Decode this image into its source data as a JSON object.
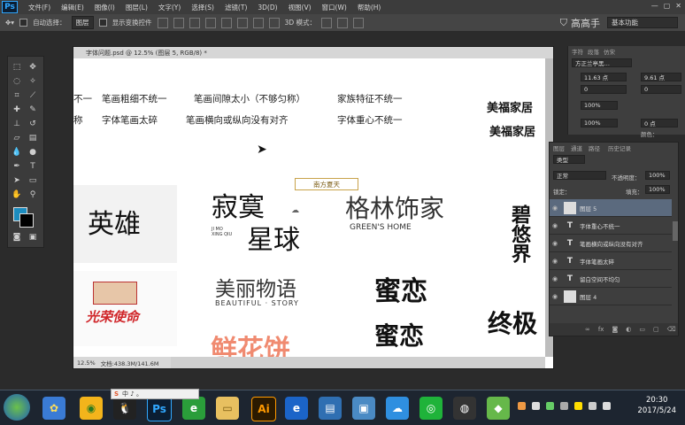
{
  "app": {
    "logo": "Ps"
  },
  "menu": [
    "文件(F)",
    "编辑(E)",
    "图像(I)",
    "图层(L)",
    "文字(Y)",
    "选择(S)",
    "滤镜(T)",
    "3D(D)",
    "视图(V)",
    "窗口(W)",
    "帮助(H)"
  ],
  "options": {
    "auto_select_label": "自动选择：",
    "auto_select_value": "图层",
    "show_transform_label": "显示变换控件",
    "mode_3d": "3D 模式："
  },
  "brand": {
    "name": "高高手"
  },
  "workspace": "基本功能",
  "document": {
    "title": "字体问题.psd @ 12.5% (图层 5, RGB/8) *",
    "zoom": "12.5%",
    "doc_info": "文档:438.3M/141.6M",
    "notes_row1": [
      "不一",
      "笔画粗细不统一",
      "笔画间隙太小（不够匀称）",
      "家族特征不统一"
    ],
    "notes_row2": [
      "称",
      "字体笔画太碎",
      "笔画横向或纵向没有对齐",
      "字体重心不统一"
    ],
    "samples": {
      "yingxiong": "英雄",
      "jimo": "寂寞",
      "xingqiu": "星球",
      "jimo_pinyin": "JI MO\nXING QIU",
      "gelin": "格林饰家",
      "gelin_en": "GREEN'S HOME",
      "meili": "美丽物语",
      "meili_en": "BEAUTIFUL · STORY",
      "milian": "蜜恋",
      "milian2": "蜜恋",
      "guangrong": "光荣使命",
      "xianhuabing": "鲜花饼",
      "zhongji": "终极",
      "meifu1": "美福家居",
      "meifu2": "美福家居",
      "bixi": "碧悠界",
      "badge": "南方夏天"
    }
  },
  "character_panel": {
    "tabs": [
      "字符",
      "段落",
      "仿宋"
    ],
    "font_family": "方正兰亭黑…",
    "font_size": "11.63 点",
    "leading": "9.61 点",
    "kerning": "0",
    "tracking": "0",
    "vscale": "100%",
    "hscale": "100%",
    "baseline": "0 点",
    "color_label": "颜色："
  },
  "layers_panel": {
    "tabs": [
      "图层",
      "通道",
      "路径",
      "历史记录"
    ],
    "filter_label": "类型",
    "blend_mode": "正常",
    "opacity_label": "不透明度：",
    "opacity_value": "100%",
    "lock_label": "锁定：",
    "fill_label": "填充：",
    "fill_value": "100%",
    "layers": [
      {
        "name": "图层 5",
        "kind": "pixel",
        "selected": true
      },
      {
        "name": "字体重心不统一",
        "kind": "text",
        "selected": false
      },
      {
        "name": "笔画横向或纵向没有对齐",
        "kind": "text",
        "selected": false
      },
      {
        "name": "字体笔画太碎",
        "kind": "text",
        "selected": false
      },
      {
        "name": "留白空间不均匀",
        "kind": "text",
        "selected": false
      },
      {
        "name": "图层 4",
        "kind": "pixel",
        "selected": false
      }
    ]
  },
  "taskbar": {
    "ime": "中 ♪ 。",
    "clock_time": "20:30",
    "clock_date": "2017/5/24",
    "apps": [
      "start",
      "pinwheel",
      "browser",
      "qq",
      "Ps",
      "ie-green",
      "folder",
      "Ai",
      "ie",
      "table",
      "photo",
      "cloud",
      "wechat",
      "obs",
      "green-app"
    ]
  },
  "colors": {
    "foreground": "#1c8cbf",
    "background": "#000000",
    "accent": "#31a8ff"
  }
}
